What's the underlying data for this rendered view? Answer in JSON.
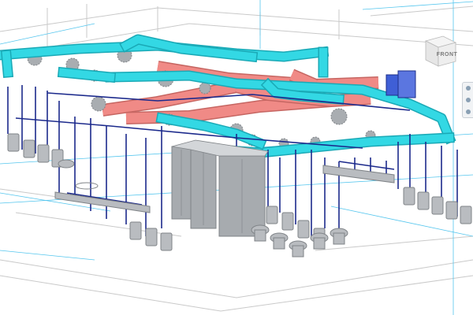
{
  "view": {
    "background": "#ffffff",
    "viewcube": {
      "face_label": "FRONT",
      "icon": "view-cube-icon"
    },
    "navigation_bar": {
      "icon": "steering-wheel-icon"
    }
  },
  "colors": {
    "supply_duct": "#33d8e4",
    "supply_duct_edge": "#1aa9b6",
    "return_duct": "#f08a86",
    "return_duct_edge": "#c66662",
    "flex_duct": "#a9adb1",
    "pipe": "#1c2a8c",
    "fixture": "#b9bcc0",
    "fixture_dark": "#7f8387",
    "cabinet": "#a7abaf",
    "grid_line": "#55c6ee",
    "architecture_line": "#c9c9c9",
    "air_handler": "#3f5fd6"
  },
  "elements": {
    "supply_ductwork": "supply-ductwork",
    "return_ductwork": "return-ductwork",
    "plumbing": "plumbing-pipes",
    "fixtures": "plumbing-fixtures",
    "equipment": "equipment-cabinets"
  }
}
